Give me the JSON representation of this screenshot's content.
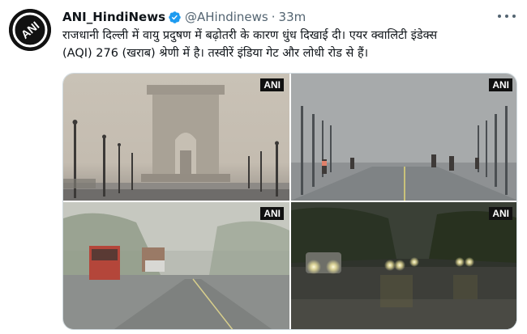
{
  "tweet": {
    "author_name": "ANI_HindiNews",
    "handle": "@AHindinews",
    "separator": "·",
    "time": "33m",
    "avatar_text": "ANI",
    "text_line1": "राजधानी दिल्ली में वायु प्रदुषण में बढ़ोतरी के कारण धुंध दिखाई दी। एयर क्वालिटी इंडेक्स",
    "text_line2": "(AQI) 276 (खराब) श्रेणी में है। तस्वीरें इंडिया गेट और लोधी रोड से हैं।"
  },
  "media": {
    "watermarks": [
      "ANI",
      "ANI",
      "ANI",
      "ANI"
    ]
  },
  "colors": {
    "verified": "#1d9bf0",
    "text_primary": "#0f1419",
    "text_secondary": "#536471"
  },
  "icons": {
    "verified": "verified-badge-icon",
    "more": "more-options-icon"
  }
}
